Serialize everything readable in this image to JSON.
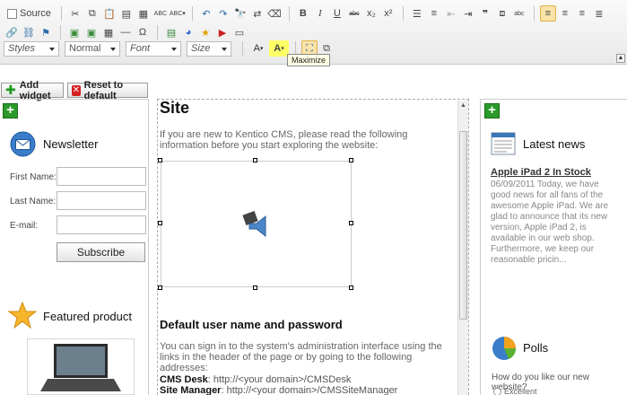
{
  "toolbar": {
    "source_label": "Source",
    "styles": "Styles",
    "format": "Normal",
    "font": "Font",
    "size": "Size",
    "maximize_tooltip": "Maximize"
  },
  "actions": {
    "add_widget": "Add widget",
    "reset": "Reset to default"
  },
  "left": {
    "newsletter_title": "Newsletter",
    "first_name_label": "First Name:",
    "last_name_label": "Last Name:",
    "email_label": "E-mail:",
    "first_name_value": "",
    "last_name_value": "",
    "email_value": "",
    "subscribe_label": "Subscribe",
    "featured_title": "Featured product"
  },
  "content": {
    "title": "Site",
    "intro": "If you are new to Kentico CMS, please read the following information before you start exploring the website:",
    "heading": "Default user name and password",
    "para": "You can sign in to the system's administration interface using the links in the header of the page or by going to the following addresses:",
    "desk_label": "CMS Desk",
    "desk_url": ": http://<your domain>/CMSDesk",
    "manager_label": "Site Manager",
    "manager_url": ": http://<your domain>/CMSSiteManager"
  },
  "right": {
    "news_title": "Latest news",
    "news_headline": "Apple iPad 2 In Stock",
    "news_body": "06/09/2011 Today, we have good news for all fans of the awesome Apple iPad. We are glad to announce that its new version, Apple iPad 2, is available in our web shop. Furthermore, we keep our reasonable pricin...",
    "polls_title": "Polls",
    "poll_question": "How do you like our new website?",
    "poll_option": "Excellent"
  }
}
